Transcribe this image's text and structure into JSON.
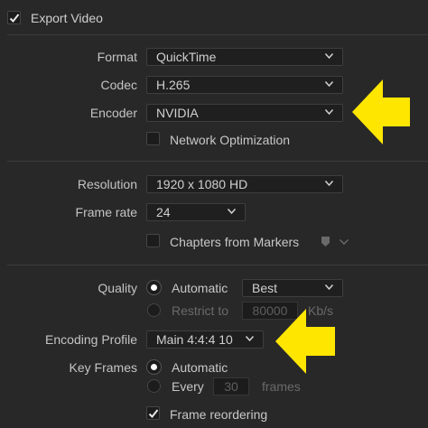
{
  "export_video": {
    "label": "Export Video",
    "checked": true
  },
  "video": {
    "format": {
      "label": "Format",
      "value": "QuickTime"
    },
    "codec": {
      "label": "Codec",
      "value": "H.265"
    },
    "encoder": {
      "label": "Encoder",
      "value": "NVIDIA"
    },
    "network_optimization": {
      "label": "Network Optimization",
      "checked": false
    }
  },
  "frame": {
    "resolution": {
      "label": "Resolution",
      "value": "1920 x 1080 HD"
    },
    "frame_rate": {
      "label": "Frame rate",
      "value": "24"
    },
    "chapters_from_markers": {
      "label": "Chapters from Markers",
      "checked": false
    }
  },
  "encoding": {
    "quality": {
      "label": "Quality",
      "automatic_label": "Automatic",
      "automatic_value": "Best",
      "restrict_label": "Restrict to",
      "restrict_value": "80000",
      "restrict_unit": "Kb/s"
    },
    "encoding_profile": {
      "label": "Encoding Profile",
      "value": "Main 4:4:4 10"
    },
    "key_frames": {
      "label": "Key Frames",
      "automatic_label": "Automatic",
      "every_label": "Every",
      "every_value": "30",
      "every_unit": "frames"
    },
    "frame_reordering": {
      "label": "Frame reordering",
      "checked": true
    }
  },
  "colors": {
    "background": "#282828",
    "dropdown_bg": "#1f1f1f",
    "text": "#c8c8c8",
    "disabled_text": "#6a6a6a",
    "arrow_annotation": "#ffe600"
  }
}
